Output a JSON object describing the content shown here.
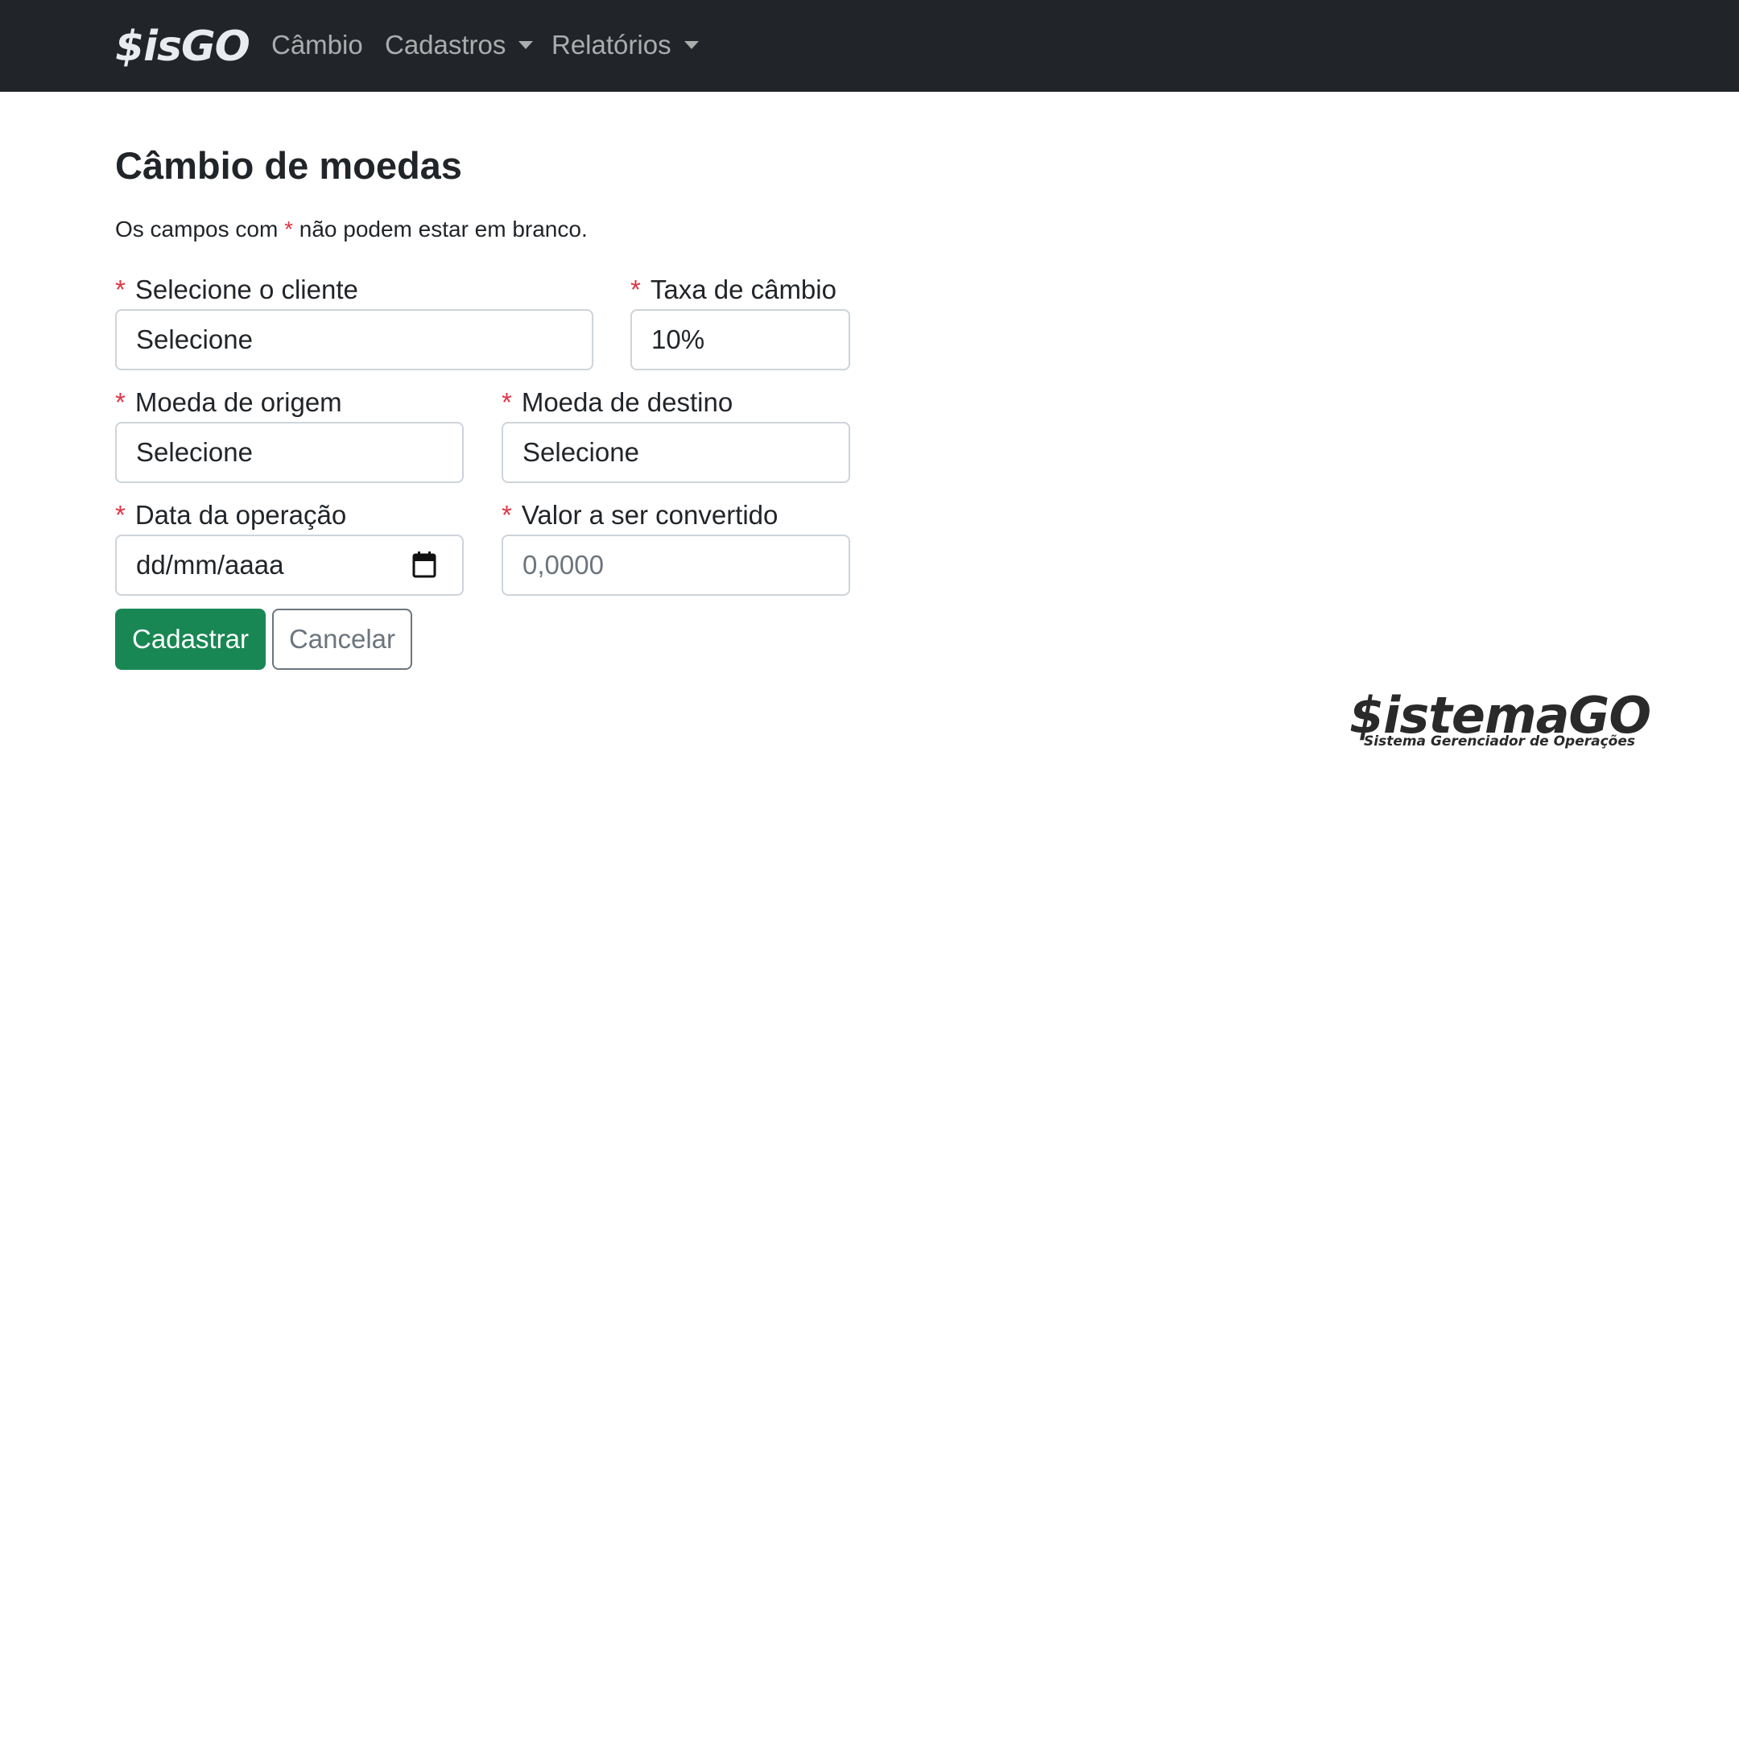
{
  "navbar": {
    "brand": "$isGO",
    "links": [
      {
        "label": "Câmbio",
        "dropdown": false
      },
      {
        "label": "Cadastros",
        "dropdown": true
      },
      {
        "label": "Relatórios",
        "dropdown": true
      }
    ]
  },
  "page": {
    "title": "Câmbio de moedas",
    "hint_before": "Os campos com",
    "required_marker": "*",
    "hint_after": "não podem estar em branco."
  },
  "form": {
    "cliente": {
      "label": "Selecione o cliente",
      "value": "Selecione"
    },
    "taxa": {
      "label": "Taxa de câmbio",
      "value": "10%"
    },
    "moeda_origem": {
      "label": "Moeda de origem",
      "value": "Selecione"
    },
    "moeda_destino": {
      "label": "Moeda de destino",
      "value": "Selecione"
    },
    "data": {
      "label": "Data da operação",
      "placeholder": "dd/mm/aaaa"
    },
    "valor": {
      "label": "Valor a ser convertido",
      "placeholder": "0,0000"
    }
  },
  "buttons": {
    "submit": "Cadastrar",
    "cancel": "Cancelar"
  },
  "logo": {
    "name": "$istemaGO",
    "tagline": "Sistema Gerenciador de Operações"
  },
  "colors": {
    "navbar_bg": "#212529",
    "required": "#dc3545",
    "submit_bg": "#198754",
    "cancel_border": "#6c757d"
  }
}
